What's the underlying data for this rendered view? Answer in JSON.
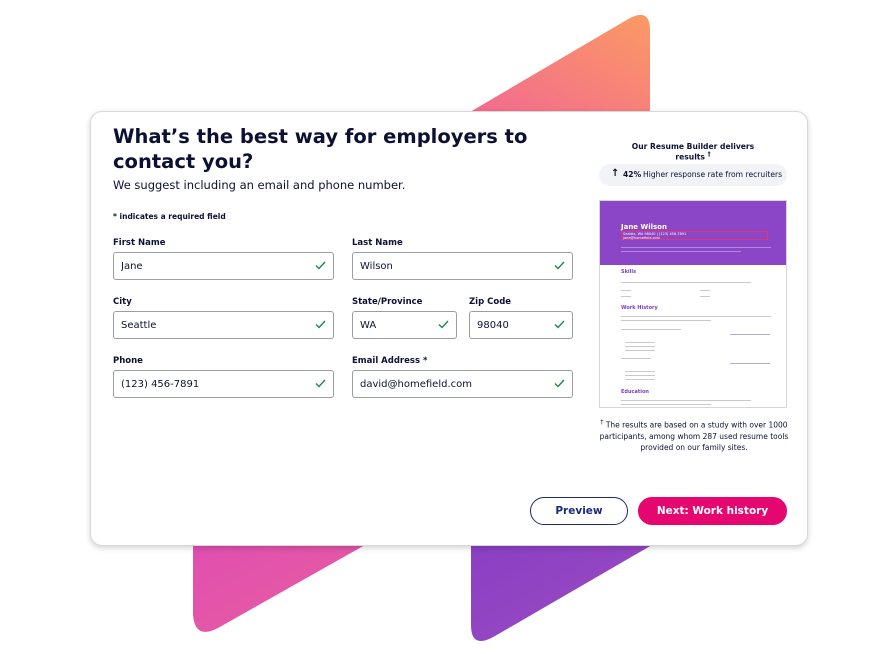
{
  "colors": {
    "accent": "#e5066f",
    "primary_text": "#0c1133",
    "resume_header": "#8a46c6",
    "check": "#1a8a4a",
    "preview_border": "#1c2a7a"
  },
  "form": {
    "title": "What’s the best way for employers to contact you?",
    "subtitle": "We suggest including an email and phone number.",
    "required_note": "* indicates a required field",
    "fields": {
      "first_name": {
        "label": "First Name",
        "value": "Jane"
      },
      "last_name": {
        "label": "Last Name",
        "value": "Wilson"
      },
      "city": {
        "label": "City",
        "value": "Seattle"
      },
      "state": {
        "label": "State/Province",
        "value": "WA"
      },
      "zip": {
        "label": "Zip Code",
        "value": "98040"
      },
      "phone": {
        "label": "Phone",
        "value": "(123) 456-7891"
      },
      "email": {
        "label": "Email Address *",
        "value": "david@homefield.com"
      }
    },
    "check_icon": "check-icon"
  },
  "sidebar": {
    "heading": "Our Resume Builder delivers results",
    "heading_mark": "†",
    "stat_arrow_icon": "arrow-up-icon",
    "stat_percent": "42%",
    "stat_text": "Higher response rate from recruiters",
    "resume": {
      "name": "Jane Wilson",
      "contact": "Seattle, WA 98040 | (123) 456-7891",
      "email": "jane@homefield.com",
      "sections": [
        "Skills",
        "Work History",
        "Education"
      ]
    },
    "footnote_mark": "†",
    "footnote": "The results are based on a study with over 1000 participants, among whom 287 used resume tools provided on our family sites."
  },
  "actions": {
    "preview_label": "Preview",
    "next_label": "Next: Work history"
  }
}
